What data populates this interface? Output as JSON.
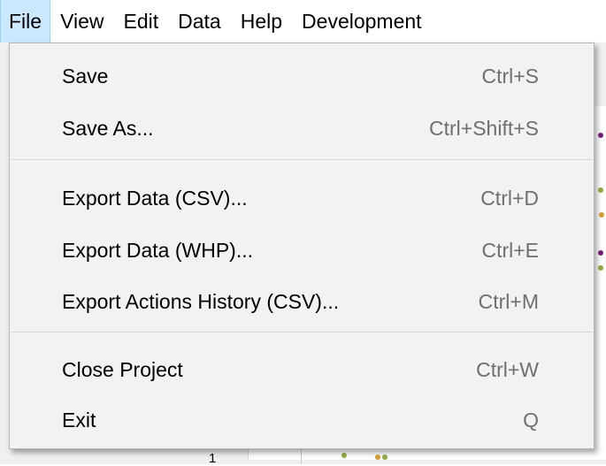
{
  "menubar": {
    "items": [
      {
        "label": "File",
        "active": true
      },
      {
        "label": "View"
      },
      {
        "label": "Edit"
      },
      {
        "label": "Data"
      },
      {
        "label": "Help"
      },
      {
        "label": "Development"
      }
    ]
  },
  "file_menu": {
    "items": [
      {
        "label": "Save",
        "shortcut": "Ctrl+S"
      },
      {
        "label": "Save As...",
        "shortcut": "Ctrl+Shift+S"
      },
      {
        "label": "Export Data (CSV)...",
        "shortcut": "Ctrl+D"
      },
      {
        "label": "Export Data (WHP)...",
        "shortcut": "Ctrl+E"
      },
      {
        "label": "Export Actions History (CSV)...",
        "shortcut": "Ctrl+M"
      },
      {
        "label": "Close Project",
        "shortcut": "Ctrl+W"
      },
      {
        "label": "Exit",
        "shortcut": "Q"
      }
    ]
  },
  "colors": {
    "menubar_active_bg": "#cce8ff",
    "menu_bg": "#f2f2f2",
    "shortcut_text": "#6f6f6f",
    "plot_dot_purple": "#7a1f7a",
    "plot_dot_green": "#8fae3f",
    "plot_dot_orange": "#d9a030"
  },
  "background": {
    "tick_label": "1"
  }
}
